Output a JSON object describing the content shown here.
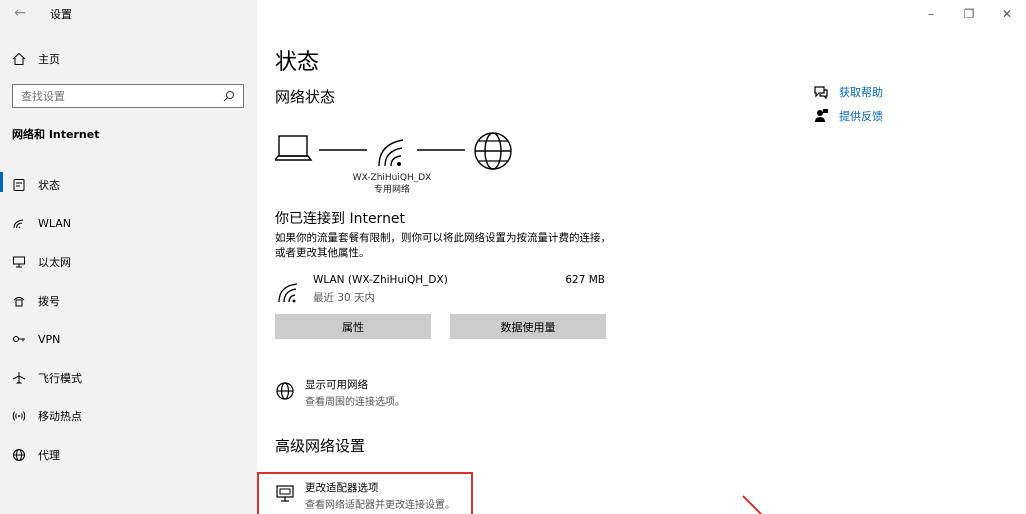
{
  "window": {
    "title": "设置",
    "back_glyph": "←",
    "minimize_glyph": "–",
    "restore_glyph": "❐",
    "close_glyph": "✕"
  },
  "sidebar": {
    "home_label": "主页",
    "search_placeholder": "查找设置",
    "section_title": "网络和 Internet",
    "items": [
      {
        "label": "状态",
        "icon": "status-icon",
        "active": true
      },
      {
        "label": "WLAN",
        "icon": "wifi-icon",
        "active": false
      },
      {
        "label": "以太网",
        "icon": "ethernet-icon",
        "active": false
      },
      {
        "label": "拨号",
        "icon": "dialup-icon",
        "active": false
      },
      {
        "label": "VPN",
        "icon": "vpn-icon",
        "active": false
      },
      {
        "label": "飞行模式",
        "icon": "airplane-icon",
        "active": false
      },
      {
        "label": "移动热点",
        "icon": "hotspot-icon",
        "active": false
      },
      {
        "label": "代理",
        "icon": "globe-icon",
        "active": false
      }
    ]
  },
  "main": {
    "page_title": "状态",
    "network_status_title": "网络状态",
    "ssid": "WX-ZhiHuiQH_DX",
    "network_type": "专用网络",
    "connected_title": "你已连接到 Internet",
    "description": "如果你的流量套餐有限制，则你可以将此网络设置为按流量计费的连接，或者更改其他属性。",
    "connection": {
      "name": "WLAN (WX-ZhiHuiQH_DX)",
      "sub": "最近 30 天内",
      "size": "627 MB"
    },
    "buttons": {
      "properties": "属性",
      "data_usage": "数据使用量"
    },
    "show_networks": {
      "title": "显示可用网络",
      "sub": "查看周围的连接选项。"
    },
    "advanced_title": "高级网络设置",
    "adapter_options": {
      "title": "更改适配器选项",
      "sub": "查看网络适配器并更改连接设置。"
    },
    "help": {
      "get_help": "获取帮助",
      "feedback": "提供反馈"
    },
    "colors": {
      "accent": "#0067c0",
      "highlight": "#d93131"
    }
  }
}
